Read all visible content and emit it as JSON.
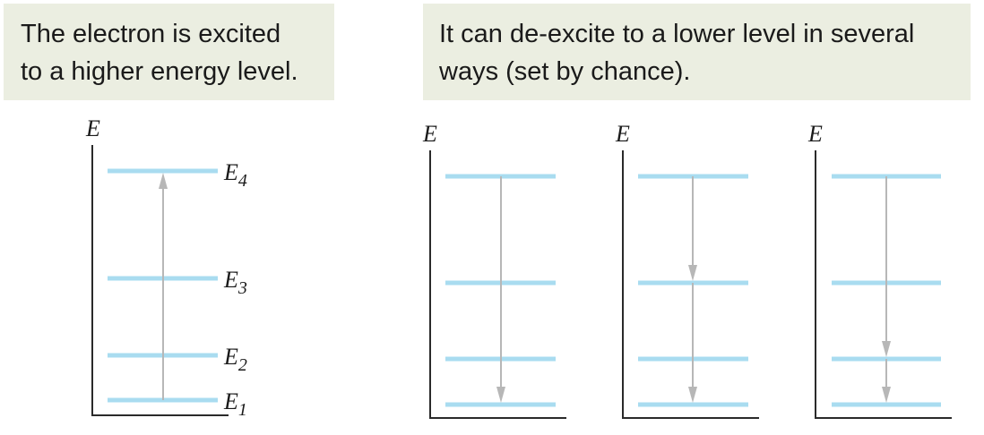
{
  "captions": {
    "left": [
      "The electron is excited",
      "to a higher energy level."
    ],
    "right": [
      "It can de-excite to a lower level in several",
      "ways (set by chance)."
    ]
  },
  "axis_label": "E",
  "level_labels": [
    {
      "base": "E",
      "sub": "4"
    },
    {
      "base": "E",
      "sub": "3"
    },
    {
      "base": "E",
      "sub": "2"
    },
    {
      "base": "E",
      "sub": "1"
    }
  ],
  "colors": {
    "level": "#a9dcf0",
    "arrow": "#b7b7b7",
    "axis": "#2a2a2a",
    "caption_bg": "#ebeee1"
  },
  "panels": [
    {
      "name": "excitation",
      "transitions": [
        [
          1,
          4
        ]
      ]
    },
    {
      "name": "direct-deexcitation",
      "transitions": [
        [
          4,
          1
        ]
      ]
    },
    {
      "name": "two-step-deexcitation",
      "transitions": [
        [
          4,
          3
        ],
        [
          3,
          1
        ]
      ]
    },
    {
      "name": "two-step-deexcitation-via-e2",
      "transitions": [
        [
          4,
          2
        ],
        [
          2,
          1
        ]
      ]
    }
  ]
}
